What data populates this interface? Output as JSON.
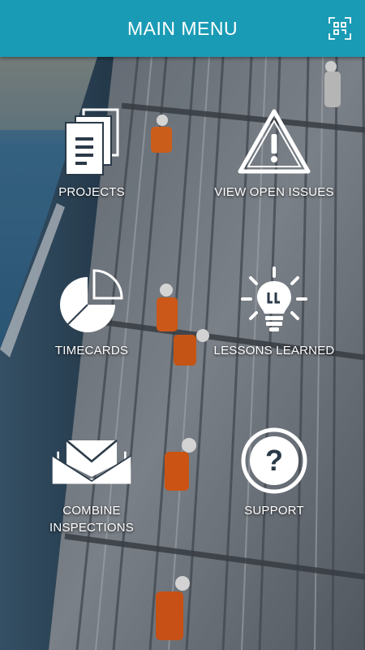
{
  "header": {
    "title": "MAIN MENU",
    "scan_icon": "qr-scan-icon"
  },
  "menu": {
    "items": [
      {
        "label": "PROJECTS",
        "icon": "documents-icon"
      },
      {
        "label": "VIEW OPEN ISSUES",
        "icon": "warning-triangle-icon"
      },
      {
        "label": "TIMECARDS",
        "icon": "pie-chart-icon"
      },
      {
        "label": "LESSONS LEARNED",
        "icon": "lightbulb-icon"
      },
      {
        "label": "COMBINE\nINSPECTIONS",
        "icon": "envelope-icon"
      },
      {
        "label": "SUPPORT",
        "icon": "help-circle-icon"
      }
    ]
  },
  "colors": {
    "header_bg": "#1a9bb5",
    "text": "#ffffff"
  }
}
